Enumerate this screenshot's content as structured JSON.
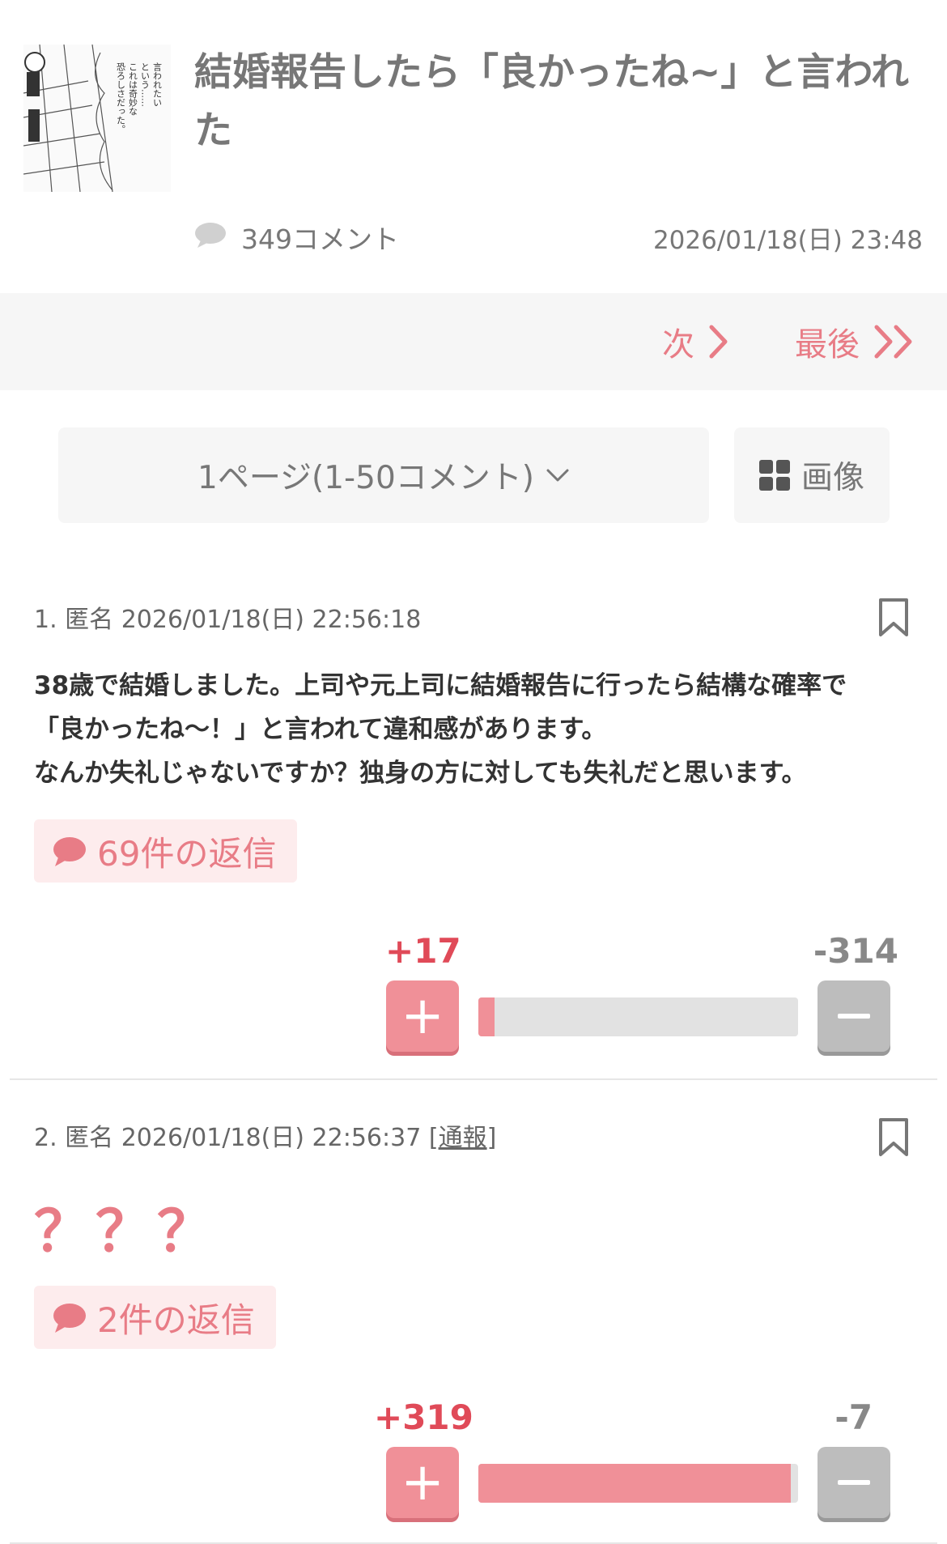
{
  "thread": {
    "title": "結婚報告したら「良かったね~」と言われた",
    "comment_count": "349コメント",
    "date": "2026/01/18(日) 23:48",
    "thumbnail_icon": "manga-panel-thumbnail",
    "thumbnail_text": "言われたいという……これは奇妙な恐ろしさだった。"
  },
  "nav": {
    "next_label": "次",
    "last_label": "最後",
    "next_icon": "chevron-right-icon",
    "last_icon": "double-chevron-right-icon"
  },
  "pager": {
    "page_label": "1ページ(1-50コメント)",
    "dropdown_icon": "chevron-down-icon",
    "image_label": "画像",
    "image_icon": "grid-icon"
  },
  "comments": [
    {
      "header": "1. 匿名 2026/01/18(日) 22:56:18",
      "body_lines": [
        "38歳で結婚しました。上司や元上司に結婚報告に行ったら結構な確率で",
        "「良かったね～！」と言われて違和感があります。",
        "なんか失礼じゃないですか？独身の方に対しても失礼だと思います。"
      ],
      "replies": "69件の返信",
      "plus": "+17",
      "minus": "-314",
      "plus_ratio": 0.051
    },
    {
      "header": "2. 匿名 2026/01/18(日) 22:56:37",
      "report_label": "通報",
      "body": "？？？",
      "replies": "2件の返信",
      "plus": "+319",
      "minus": "-7",
      "plus_ratio": 0.978
    }
  ],
  "colors": {
    "accent": "#e87c86",
    "plus": "#f09098",
    "minus": "#bdbdbd",
    "background_gray": "#f6f6f6"
  }
}
